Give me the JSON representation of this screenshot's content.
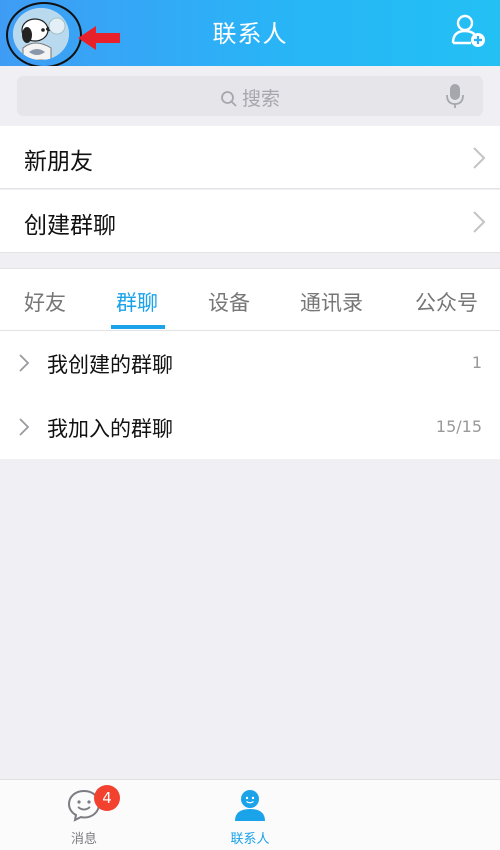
{
  "header": {
    "title": "联系人",
    "colors": {
      "start": "#3f9cf5",
      "end": "#23c0f4"
    },
    "avatar_icon": "snoopy-avatar",
    "annotation_arrow_color": "#e8202a",
    "add_contact_icon": "add-contact-icon"
  },
  "search": {
    "placeholder": "搜索",
    "search_icon": "search-icon",
    "mic_icon": "microphone-icon"
  },
  "rows": [
    {
      "label": "新朋友"
    },
    {
      "label": "创建群聊"
    }
  ],
  "tabs": [
    {
      "label": "好友",
      "active": false
    },
    {
      "label": "群聊",
      "active": true
    },
    {
      "label": "设备",
      "active": false
    },
    {
      "label": "通讯录",
      "active": false
    },
    {
      "label": "公众号",
      "active": false
    }
  ],
  "groups": [
    {
      "label": "我创建的群聊",
      "count": "1"
    },
    {
      "label": "我加入的群聊",
      "count": "15/15"
    }
  ],
  "bottom_nav": {
    "items": [
      {
        "label": "消息",
        "icon": "message-bubble-icon",
        "badge": "4",
        "active": false
      },
      {
        "label": "联系人",
        "icon": "contact-person-icon",
        "active": true
      }
    ],
    "accent": "#1aa3e9",
    "badge_color": "#f2412f"
  }
}
